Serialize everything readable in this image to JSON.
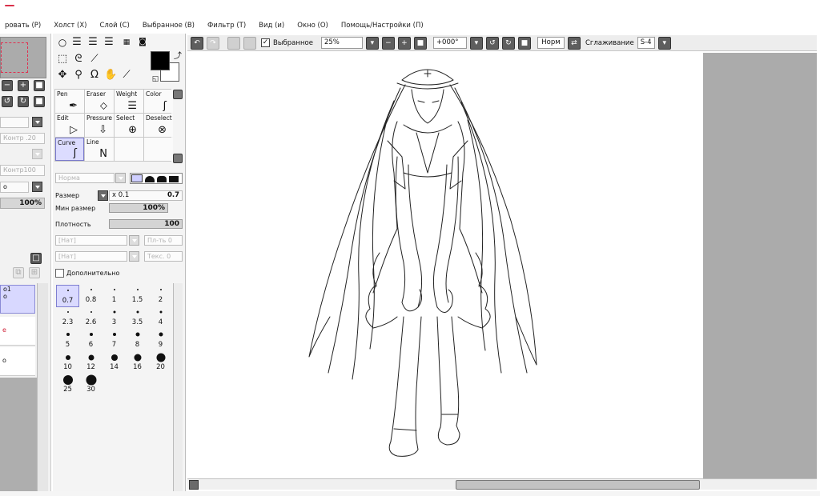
{
  "menubar": {
    "items": [
      "ровать (P)",
      "Холст (X)",
      "Слой (C)",
      "Выбранное (B)",
      "Фильтр (T)",
      "Вид (и)",
      "Окно (O)",
      "Помощь/Настройки (П)"
    ]
  },
  "left_panel": {
    "field1": "Контр .20",
    "field2": "Контр100",
    "field3": "о",
    "percent": "100%",
    "layers": [
      {
        "line1": "о1",
        "line2": "о"
      },
      {
        "line1": "е",
        "line2": ""
      },
      {
        "line1": "о",
        "line2": ""
      }
    ]
  },
  "tools": [
    {
      "label": "Pen",
      "glyph": "✒"
    },
    {
      "label": "Eraser",
      "glyph": "⬦"
    },
    {
      "label": "Weight",
      "glyph": "☰"
    },
    {
      "label": "Color",
      "glyph": "ʃ"
    },
    {
      "label": "Edit",
      "glyph": "▷"
    },
    {
      "label": "Pressure",
      "glyph": "⇩"
    },
    {
      "label": "Select",
      "glyph": "⊕"
    },
    {
      "label": "Deselect",
      "glyph": "⊗"
    },
    {
      "label": "Curve",
      "glyph": "ʃ"
    },
    {
      "label": "Line",
      "glyph": "N"
    }
  ],
  "params": {
    "blend_mode": "Норма",
    "size_label": "Размер",
    "size_multiplier": "x 0.1",
    "size_value": "0.7",
    "min_size_label": "Мин размер",
    "min_size_value": "100%",
    "density_label": "Плотность",
    "density_value": "100",
    "texture1": "[Нат]",
    "texture1_amount": "Пл-ть 0",
    "texture2": "[Нат]",
    "texture2_amount": "Текс. 0",
    "advanced_label": "Дополнительно"
  },
  "brush_sizes": [
    "0.7",
    "0.8",
    "1",
    "1.5",
    "2",
    "2.3",
    "2.6",
    "3",
    "3.5",
    "4",
    "5",
    "6",
    "7",
    "8",
    "9",
    "10",
    "12",
    "14",
    "16",
    "20",
    "25",
    "30"
  ],
  "topbar": {
    "selection_label": "Выбранное",
    "zoom": "25%",
    "rotation": "+000°",
    "mode_button": "Норм",
    "smoothing_label": "Сглаживание",
    "smoothing_value": "S-4"
  }
}
